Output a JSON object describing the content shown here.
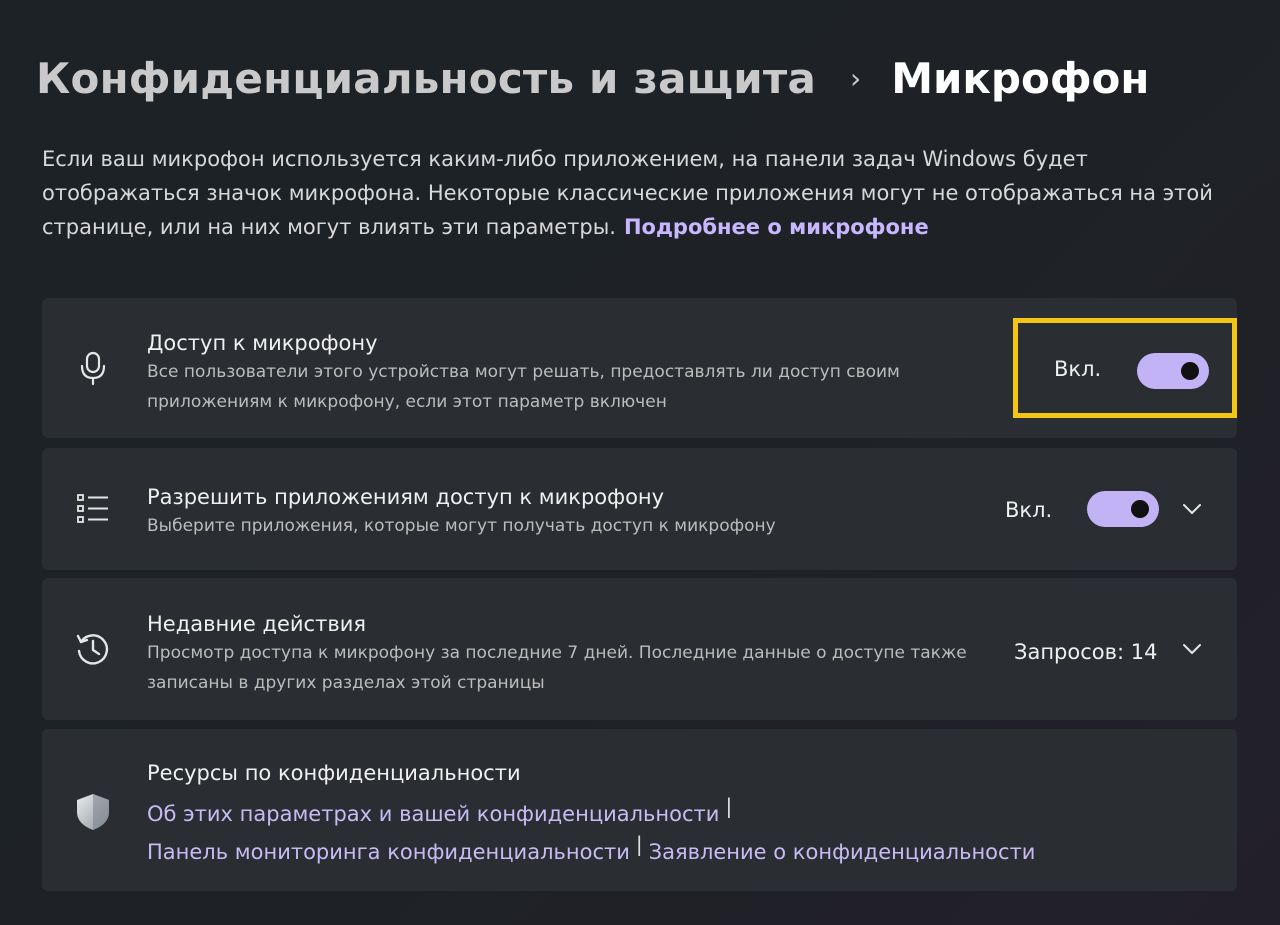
{
  "breadcrumb": {
    "parent": "Конфиденциальность и защита",
    "separator": "›",
    "current": "Микрофон"
  },
  "intro": {
    "text": "Если ваш микрофон используется каким-либо приложением, на панели задач Windows будет отображаться значок микрофона. Некоторые классические приложения могут не отображаться на этой странице, или на них могут влиять эти параметры.",
    "link": "Подробнее о микрофоне"
  },
  "cards": {
    "mic_access": {
      "icon": "microphone-icon",
      "title": "Доступ к микрофону",
      "description": "Все пользователи этого устройства могут решать, предоставлять ли доступ своим приложениям к микрофону, если этот параметр включен",
      "state_label": "Вкл.",
      "toggle_on": true
    },
    "app_access": {
      "icon": "list-icon",
      "title": "Разрешить приложениям доступ к микрофону",
      "description": "Выберите приложения, которые могут получать доступ к микрофону",
      "state_label": "Вкл.",
      "toggle_on": true
    },
    "recent_activity": {
      "icon": "history-icon",
      "title": "Недавние действия",
      "description": "Просмотр доступа к микрофону за последние 7 дней. Последние данные о доступе также записаны в других разделах этой страницы",
      "requests_label": "Запросов: 14"
    },
    "privacy_resources": {
      "icon": "shield-icon",
      "title": "Ресурсы по конфиденциальности",
      "links": [
        "Об этих параметрах и вашей конфиденциальности",
        "Панель мониторинга конфиденциальности",
        "Заявление о конфиденциальности"
      ],
      "separator": "|"
    }
  },
  "colors": {
    "background": "#1e2226",
    "card": "#2a2d31",
    "accent": "#c2b3f6",
    "link": "#c8bbf5",
    "highlight": "#f4c613"
  }
}
